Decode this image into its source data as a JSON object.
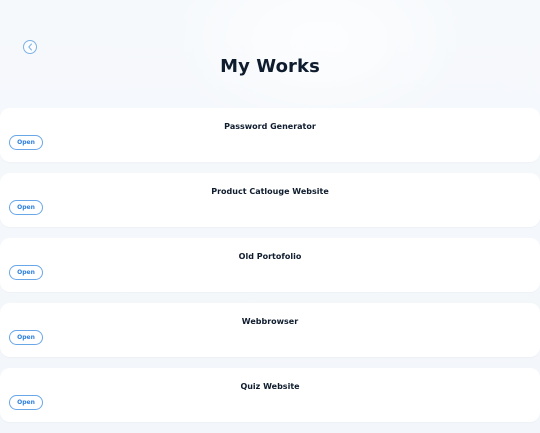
{
  "header": {
    "title": "My Works"
  },
  "icons": {
    "back": "chevron-left-icon"
  },
  "works": [
    {
      "title": "Password Generator",
      "button_label": "Open"
    },
    {
      "title": "Product Catlouge Website",
      "button_label": "Open"
    },
    {
      "title": "Old Portofolio",
      "button_label": "Open"
    },
    {
      "title": "Webbrowser",
      "button_label": "Open"
    },
    {
      "title": "Quiz Website",
      "button_label": "Open"
    }
  ],
  "colors": {
    "accent": "#2d7fe0",
    "accent_border": "#6aa7e8",
    "background": "#f3f7fb",
    "card": "#ffffff",
    "text": "#0f1c2e"
  }
}
